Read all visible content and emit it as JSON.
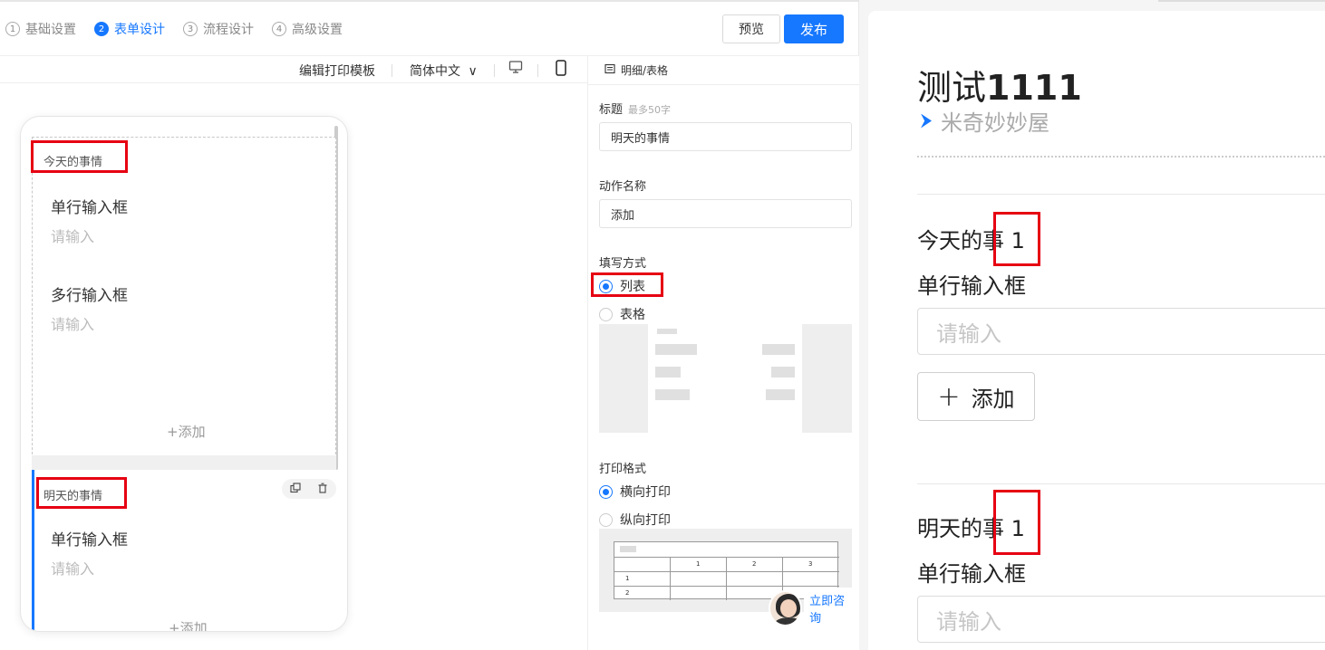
{
  "steps": [
    {
      "num": "1",
      "label": "基础设置"
    },
    {
      "num": "2",
      "label": "表单设计"
    },
    {
      "num": "3",
      "label": "流程设计"
    },
    {
      "num": "4",
      "label": "高级设置"
    }
  ],
  "actions": {
    "preview": "预览",
    "publish": "发布"
  },
  "toolbar": {
    "print_template": "编辑打印模板",
    "language": "简体中文",
    "language_chevron": "∨"
  },
  "phone": {
    "block1": {
      "title": "今天的事情",
      "fields": [
        {
          "label": "单行输入框",
          "placeholder": "请输入"
        },
        {
          "label": "多行输入框",
          "placeholder": "请输入"
        }
      ],
      "add": "+添加"
    },
    "block2": {
      "title": "明天的事情",
      "fields": [
        {
          "label": "单行输入框",
          "placeholder": "请输入"
        }
      ],
      "add": "+添加"
    }
  },
  "props": {
    "header": "明细/表格",
    "title_label": "标题",
    "title_hint": "最多50字",
    "title_value": "明天的事情",
    "action_label": "动作名称",
    "action_value": "添加",
    "fill_label": "填写方式",
    "fill_options": [
      "列表",
      "表格"
    ],
    "print_label": "打印格式",
    "print_options": [
      "横向打印",
      "纵向打印"
    ],
    "mini_table_header": [
      "1",
      "2",
      "3"
    ],
    "mini_table_rows": [
      "1",
      "2"
    ]
  },
  "consult": "立即咨询",
  "preview": {
    "title_prefix": "测试",
    "title_bold": "1111",
    "subtitle": "米奇妙妙屋",
    "section1_title": "今天的事",
    "section1_suffix": "1",
    "field1_label": "单行输入框",
    "field1_placeholder": "请输入",
    "add_label": "添加",
    "add_icon": "+",
    "section2_title": "明天的事",
    "section2_suffix": "1",
    "field2_label": "单行输入框",
    "field2_placeholder": "请输入"
  },
  "colors": {
    "accent": "#1677ff",
    "highlight": "#e60012"
  }
}
